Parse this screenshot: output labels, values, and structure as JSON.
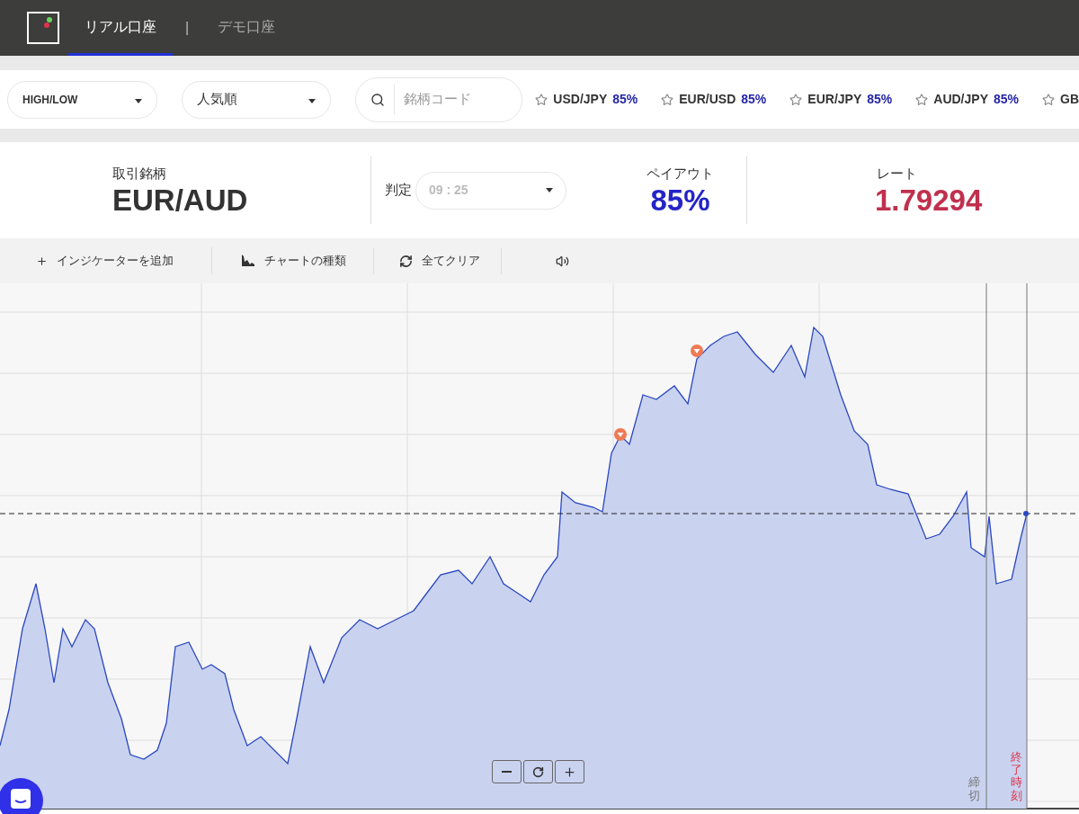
{
  "header": {
    "tabs": [
      {
        "label": "リアル口座",
        "selected": true
      },
      {
        "label": "デモ口座",
        "selected": false
      }
    ],
    "separator": "|"
  },
  "filters": {
    "dropdowns": [
      {
        "value": "HIGH/LOW"
      },
      {
        "value": "人気順"
      }
    ],
    "search": {
      "placeholder": "銘柄コード"
    },
    "favorites": [
      {
        "pair": "USD/JPY",
        "payout": "85%"
      },
      {
        "pair": "EUR/USD",
        "payout": "85%"
      },
      {
        "pair": "EUR/JPY",
        "payout": "85%"
      },
      {
        "pair": "AUD/JPY",
        "payout": "85%"
      },
      {
        "pair": "GB"
      }
    ]
  },
  "info": {
    "symbol_label": "取引銘柄",
    "symbol": "EUR/AUD",
    "judge_label": "判定",
    "judge_time": "09 : 25",
    "payout_label": "ペイアウト",
    "payout": "85%",
    "rate_label": "レート",
    "rate": "1.79294"
  },
  "toolbar": [
    {
      "kind": "add",
      "label": "インジケーターを追加"
    },
    {
      "kind": "chart",
      "label": "チャートの種類"
    },
    {
      "kind": "clear",
      "label": "全てクリア"
    },
    {
      "kind": "sound"
    }
  ],
  "chart": {
    "deadline_label": "締切",
    "end_label": "終了時刻"
  }
}
